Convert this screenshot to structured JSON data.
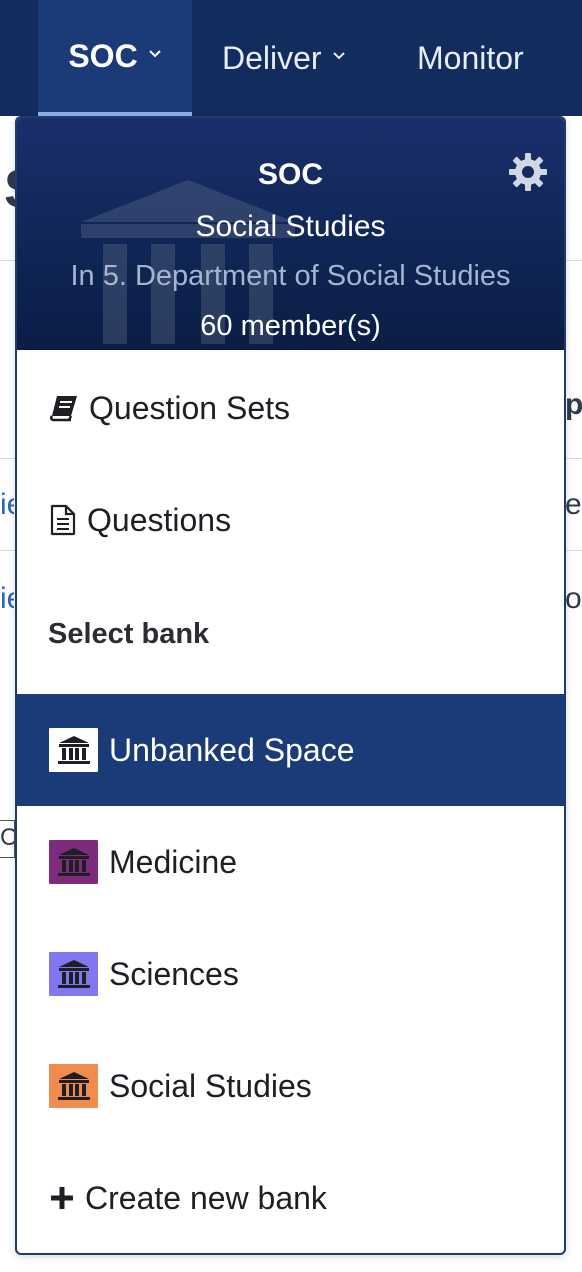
{
  "nav": {
    "items": [
      {
        "label": "SOC"
      },
      {
        "label": "Deliver"
      },
      {
        "label": "Monitor"
      }
    ]
  },
  "background": {
    "col_right_fragment": "py",
    "row1_left": "ie",
    "row1_right": "er",
    "row2_left": "ie",
    "row2_right": "or",
    "row3_left": "C"
  },
  "dropdown": {
    "header": {
      "code": "SOC",
      "name": "Social Studies",
      "department": "In 5. Department of Social Studies",
      "members": "60 member(s)"
    },
    "links": [
      {
        "label": "Question Sets",
        "icon": "book-icon"
      },
      {
        "label": "Questions",
        "icon": "document-icon"
      }
    ],
    "section_label": "Select bank",
    "banks": [
      {
        "label": "Unbanked Space",
        "tile_color": "#ffffff",
        "icon": "bank-icon",
        "selected": true
      },
      {
        "label": "Medicine",
        "tile_color": "#7d2b7d",
        "icon": "bank-icon",
        "selected": false
      },
      {
        "label": "Sciences",
        "tile_color": "#7f78f0",
        "icon": "bank-icon",
        "selected": false
      },
      {
        "label": "Social Studies",
        "tile_color": "#f28b4e",
        "icon": "bank-icon",
        "selected": false
      }
    ],
    "create_label": "Create new bank",
    "create_icon": "plus-icon"
  },
  "colors": {
    "nav_bg": "#132c5e",
    "nav_active": "#1b3a78",
    "selected_row": "#1a3a78"
  }
}
